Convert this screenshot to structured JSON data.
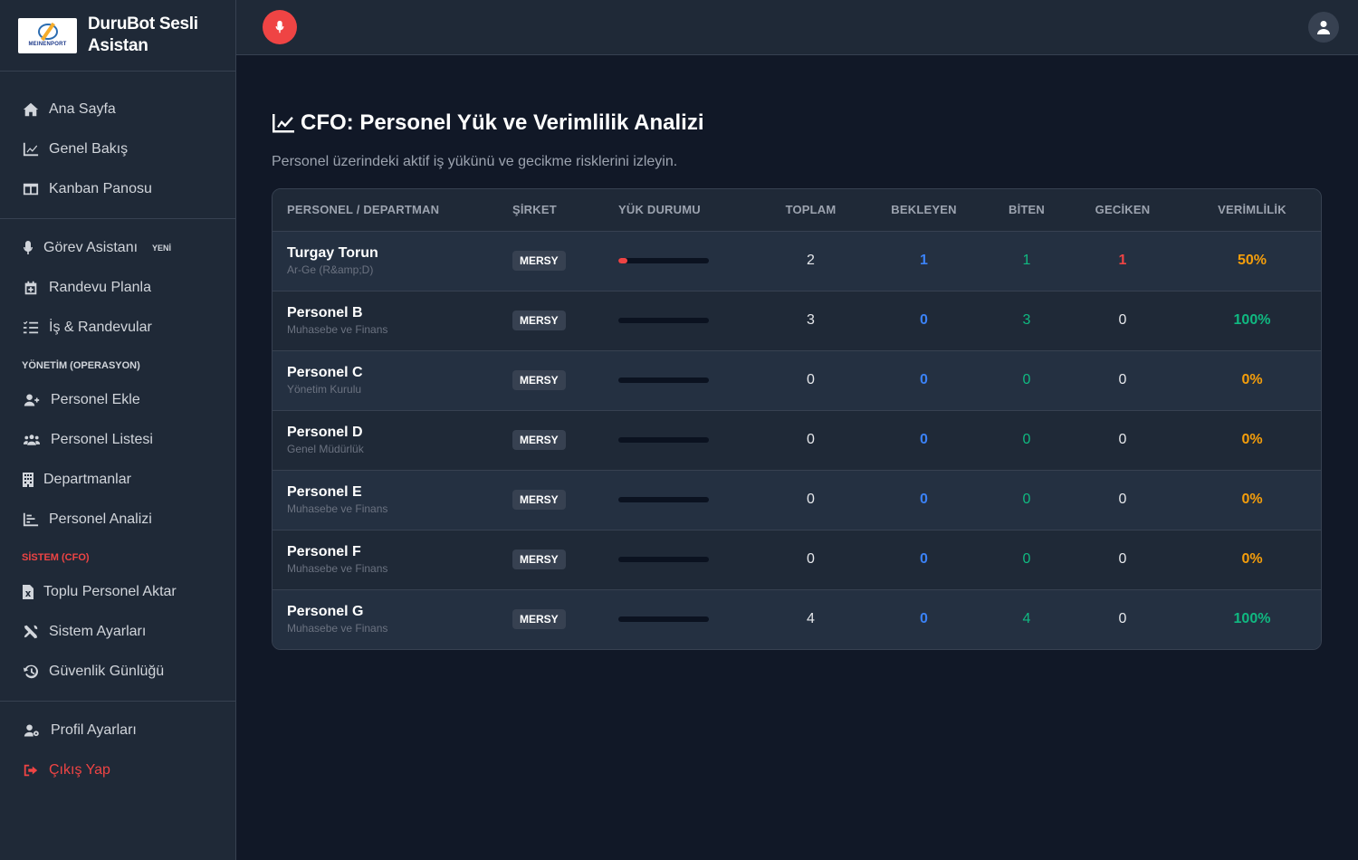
{
  "brand": {
    "title": "DuruBot Sesli Asistan",
    "logo_text": "MEINENPORT"
  },
  "nav": {
    "primary": [
      {
        "label": "Ana Sayfa",
        "icon": "home-icon"
      },
      {
        "label": "Genel Bakış",
        "icon": "chart-line-icon"
      },
      {
        "label": "Kanban Panosu",
        "icon": "kanban-icon"
      }
    ],
    "assistant": [
      {
        "label": "Görev Asistanı",
        "icon": "microphone-icon",
        "badge": "YENİ"
      },
      {
        "label": "Randevu Planla",
        "icon": "calendar-plus-icon"
      },
      {
        "label": "İş & Randevular",
        "icon": "list-check-icon"
      }
    ],
    "management_label": "YÖNETİM (OPERASYON)",
    "management": [
      {
        "label": "Personel Ekle",
        "icon": "user-plus-icon"
      },
      {
        "label": "Personel Listesi",
        "icon": "users-icon"
      },
      {
        "label": "Departmanlar",
        "icon": "building-icon"
      },
      {
        "label": "Personel Analizi",
        "icon": "chart-bar-icon"
      }
    ],
    "system_label": "SİSTEM (CFO)",
    "system": [
      {
        "label": "Toplu Personel Aktar",
        "icon": "file-excel-icon"
      },
      {
        "label": "Sistem Ayarları",
        "icon": "tools-icon"
      },
      {
        "label": "Güvenlik Günlüğü",
        "icon": "history-icon"
      }
    ],
    "footer": [
      {
        "label": "Profil Ayarları",
        "icon": "user-gear-icon"
      },
      {
        "label": "Çıkış Yap",
        "icon": "sign-out-icon"
      }
    ]
  },
  "page": {
    "title": "CFO: Personel Yük ve Verimlilik Analizi",
    "subtitle": "Personel üzerindeki aktif iş yükünü ve gecikme risklerini izleyin."
  },
  "table": {
    "headers": [
      "PERSONEL / DEPARTMAN",
      "ŞİRKET",
      "YÜK DURUMU",
      "TOPLAM",
      "BEKLEYEN",
      "BİTEN",
      "GECİKEN",
      "VERİMLİLİK"
    ],
    "rows": [
      {
        "name": "Turgay Torun",
        "dept": "Ar-Ge (R&amp;D)",
        "company": "MERSY",
        "load": 0.1,
        "total": "2",
        "pending": "1",
        "done": "1",
        "late": "1",
        "eff": "50%",
        "eff_color": "#f59e0b"
      },
      {
        "name": "Personel B",
        "dept": "Muhasebe ve Finans",
        "company": "MERSY",
        "load": 0,
        "total": "3",
        "pending": "0",
        "done": "3",
        "late": "0",
        "eff": "100%",
        "eff_color": "#10b981"
      },
      {
        "name": "Personel C",
        "dept": "Yönetim Kurulu",
        "company": "MERSY",
        "load": 0,
        "total": "0",
        "pending": "0",
        "done": "0",
        "late": "0",
        "eff": "0%",
        "eff_color": "#f59e0b"
      },
      {
        "name": "Personel D",
        "dept": "Genel Müdürlük",
        "company": "MERSY",
        "load": 0,
        "total": "0",
        "pending": "0",
        "done": "0",
        "late": "0",
        "eff": "0%",
        "eff_color": "#f59e0b"
      },
      {
        "name": "Personel E",
        "dept": "Muhasebe ve Finans",
        "company": "MERSY",
        "load": 0,
        "total": "0",
        "pending": "0",
        "done": "0",
        "late": "0",
        "eff": "0%",
        "eff_color": "#f59e0b"
      },
      {
        "name": "Personel F",
        "dept": "Muhasebe ve Finans",
        "company": "MERSY",
        "load": 0,
        "total": "0",
        "pending": "0",
        "done": "0",
        "late": "0",
        "eff": "0%",
        "eff_color": "#f59e0b"
      },
      {
        "name": "Personel G",
        "dept": "Muhasebe ve Finans",
        "company": "MERSY",
        "load": 0,
        "total": "4",
        "pending": "0",
        "done": "4",
        "late": "0",
        "eff": "100%",
        "eff_color": "#10b981"
      }
    ]
  }
}
